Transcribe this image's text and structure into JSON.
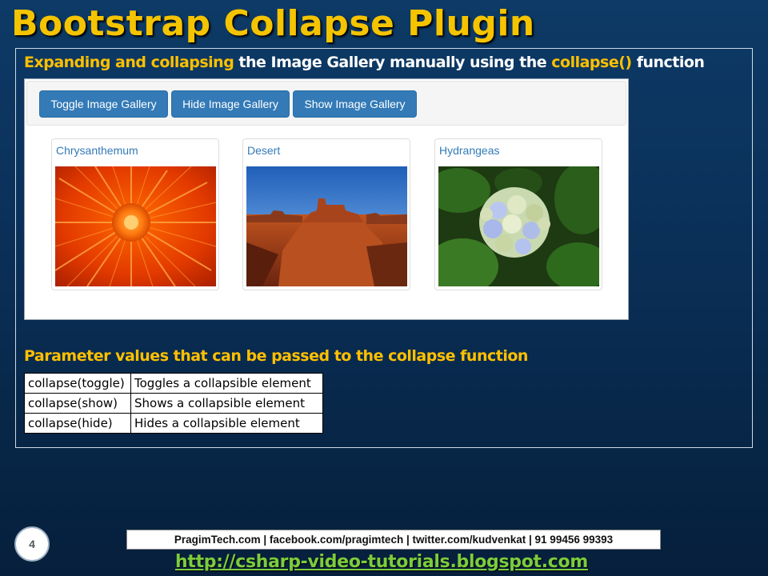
{
  "slide": {
    "title": "Bootstrap Collapse Plugin",
    "heading": {
      "part1": "Expanding and collapsing",
      "part2": " the Image Gallery manually using the ",
      "part3": "collapse()",
      "part4": " function"
    },
    "page_number": "4"
  },
  "toolbar": {
    "toggle_label": "Toggle Image Gallery",
    "hide_label": "Hide Image Gallery",
    "show_label": "Show Image Gallery"
  },
  "gallery": {
    "items": [
      {
        "caption": "Chrysanthemum",
        "icon": "chrysanthemum-photo"
      },
      {
        "caption": "Desert",
        "icon": "desert-photo"
      },
      {
        "caption": "Hydrangeas",
        "icon": "hydrangeas-photo"
      }
    ]
  },
  "params": {
    "heading": "Parameter values that can be passed to the collapse function",
    "rows": [
      {
        "call": "collapse(toggle)",
        "desc": "Toggles a collapsible element"
      },
      {
        "call": "collapse(show)",
        "desc": "Shows a collapsible element"
      },
      {
        "call": "collapse(hide)",
        "desc": "Hides a collapsible element"
      }
    ]
  },
  "footer": {
    "info": "PragimTech.com | facebook.com/pragimtech  | twitter.com/kudvenkat  | 91 99456 99393",
    "url": "http://csharp-video-tutorials.blogspot.com"
  },
  "colors": {
    "title": "#f5c400",
    "highlight": "#ffc000",
    "button": "#337ab7",
    "link_url": "#7ccc3c"
  }
}
